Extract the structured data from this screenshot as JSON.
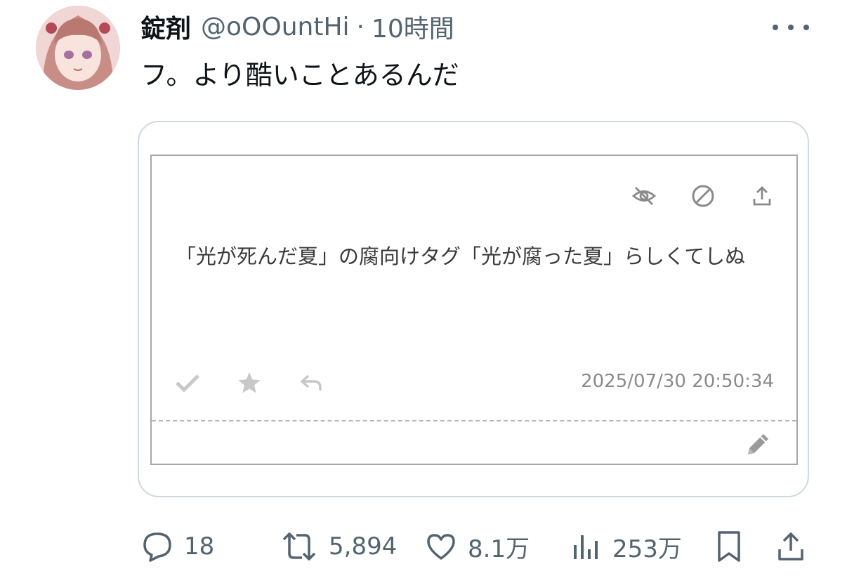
{
  "tweet": {
    "author_name": "錠剤",
    "handle": "@oOOuntHi",
    "separator": "·",
    "time_ago": "10時間",
    "text": "フ。より酷いことあるんだ"
  },
  "embedded_card": {
    "text": "「光が死んだ夏」の腐向けタグ「光が腐った夏」らしくてしぬ",
    "timestamp": "2025/07/30 20:50:34",
    "top_icons": [
      "eye-slash-icon",
      "ban-icon",
      "share-icon"
    ],
    "action_icons": [
      "check-icon",
      "star-icon",
      "reply-icon"
    ],
    "edit_icon": "pencil-icon"
  },
  "actions": {
    "replies": "18",
    "reposts": "5,894",
    "likes": "8.1万",
    "views": "253万"
  },
  "colors": {
    "text_primary": "#0f1419",
    "text_secondary": "#536471",
    "border": "#cfd9de",
    "card_icon": "#8a8a8a",
    "card_action_icon": "#c8c8c8"
  }
}
